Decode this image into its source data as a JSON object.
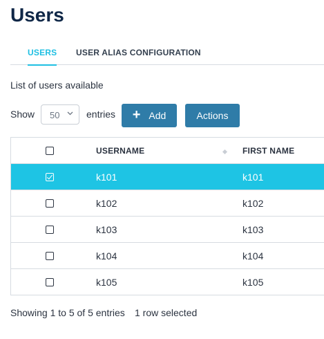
{
  "page": {
    "title": "Users"
  },
  "tabs": [
    {
      "label": "USERS",
      "active": true
    },
    {
      "label": "USER ALIAS CONFIGURATION",
      "active": false
    }
  ],
  "subtitle": "List of users available",
  "length_control": {
    "show_label": "Show",
    "value": "50",
    "entries_label": "entries"
  },
  "toolbar": {
    "add_label": "Add",
    "actions_label": "Actions"
  },
  "table": {
    "columns": [
      "USERNAME",
      "FIRST NAME"
    ],
    "rows": [
      {
        "username": "k101",
        "first_name": "k101",
        "selected": true
      },
      {
        "username": "k102",
        "first_name": "k102",
        "selected": false
      },
      {
        "username": "k103",
        "first_name": "k103",
        "selected": false
      },
      {
        "username": "k104",
        "first_name": "k104",
        "selected": false
      },
      {
        "username": "k105",
        "first_name": "k105",
        "selected": false
      }
    ]
  },
  "footer": {
    "info": "Showing 1 to 5 of 5 entries",
    "selection": "1 row selected"
  },
  "colors": {
    "accent": "#1ec4e4",
    "button": "#2f7ca8",
    "title": "#0f2747"
  }
}
